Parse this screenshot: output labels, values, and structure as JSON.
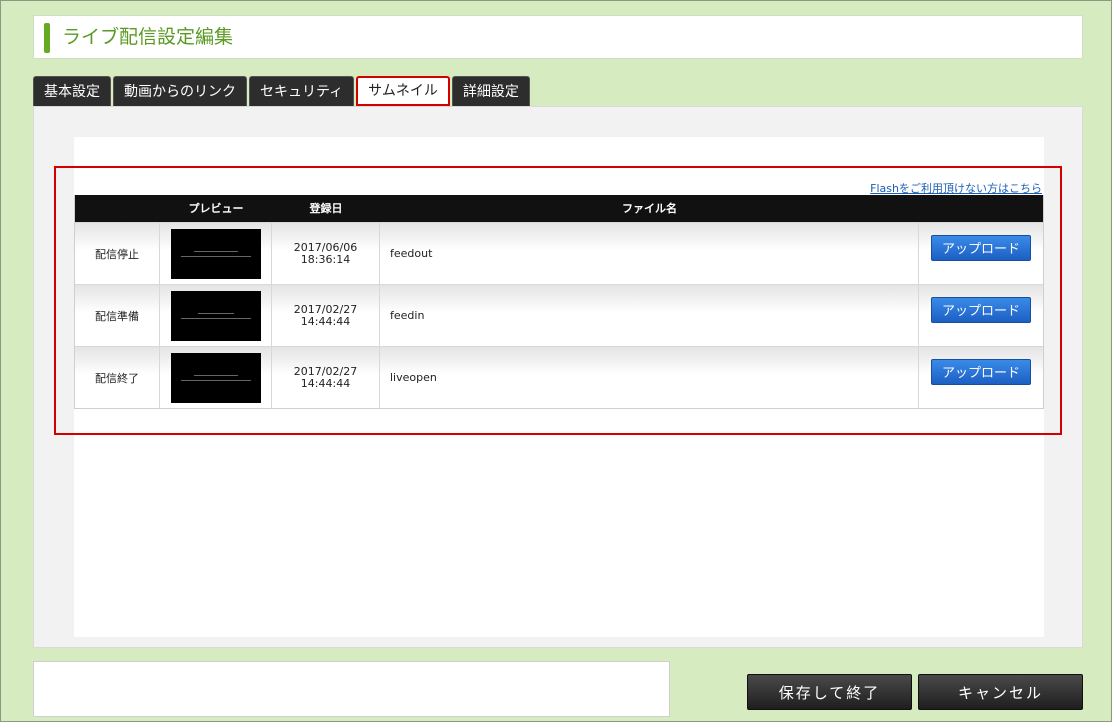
{
  "header": {
    "title": "ライブ配信設定編集"
  },
  "tabs": [
    {
      "label": "基本設定"
    },
    {
      "label": "動画からのリンク"
    },
    {
      "label": "セキュリティ"
    },
    {
      "label": "サムネイル",
      "active": true
    },
    {
      "label": "詳細設定"
    }
  ],
  "thumbnails": {
    "flash_link": "Flashをご利用頂けない方はこちら",
    "columns": {
      "status": "",
      "preview": "プレビュー",
      "date": "登録日",
      "file": "ファイル名",
      "action": ""
    },
    "rows": [
      {
        "status": "配信停止",
        "date": "2017/06/06",
        "time": "18:36:14",
        "file": "feedout",
        "button": "アップロード"
      },
      {
        "status": "配信準備",
        "date": "2017/02/27",
        "time": "14:44:44",
        "file": "feedin",
        "button": "アップロード"
      },
      {
        "status": "配信終了",
        "date": "2017/02/27",
        "time": "14:44:44",
        "file": "liveopen",
        "button": "アップロード"
      }
    ]
  },
  "footer": {
    "save_label": "保存して終了",
    "cancel_label": "キャンセル"
  },
  "colors": {
    "accent": "#66aa22",
    "highlight": "#d40000",
    "upload": "#1c5fc4"
  }
}
